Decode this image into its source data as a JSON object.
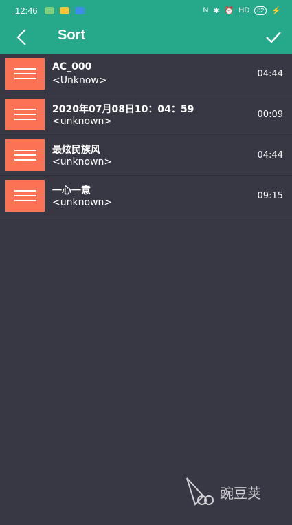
{
  "status_bar": {
    "time": "12:46",
    "network": "HD",
    "battery": "82"
  },
  "app_bar": {
    "title": "Sort",
    "back_icon": "chevron-left-icon",
    "confirm_icon": "check-icon"
  },
  "songs": [
    {
      "title": "AC_000",
      "artist": "<Unknow>",
      "duration": "04:44"
    },
    {
      "title": "2020年07月08日10：04：59",
      "artist": "<unknown>",
      "duration": "00:09"
    },
    {
      "title": "最炫民族风",
      "artist": "<unknown>",
      "duration": "04:44"
    },
    {
      "title": "一心一意",
      "artist": "<unknown>",
      "duration": "09:15"
    }
  ],
  "watermark": {
    "text": "豌豆荚"
  },
  "colors": {
    "accent": "#26a98a",
    "handle": "#fb7254",
    "background": "#383845"
  }
}
